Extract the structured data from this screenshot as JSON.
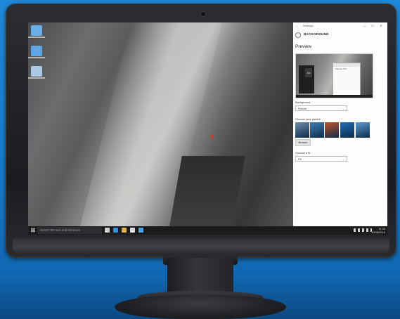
{
  "settings": {
    "window_title": "Settings",
    "back_glyph": "←",
    "controls": [
      "—",
      "☐",
      "✕"
    ],
    "header_icon": "gear-icon",
    "header": "BACKGROUND",
    "preview_heading": "Preview",
    "preview_sample_text": "Sample Text",
    "preview_tile_text": "Aa",
    "background_label": "Background",
    "background_value": "Picture",
    "choose_picture_label": "Choose your picture",
    "browse_label": "Browse",
    "choose_fit_label": "Choose a fit",
    "fit_value": "Fill",
    "picture_colors": [
      "#6f8ea8",
      "#3f7fb5",
      "#c4552a",
      "#1f6fb8",
      "#5b9cd1"
    ]
  },
  "taskbar": {
    "start_glyph": "⊞",
    "search_placeholder": "Search the web and Windows",
    "time": "11:30",
    "date": "10/08/2015",
    "app_icon_colors": [
      "#cfcfcf",
      "#2f8fe0",
      "#e2b13c",
      "#dcdcdc",
      "#4aa0e6"
    ]
  },
  "desktop": {
    "icon_colors": [
      "#6aaee8",
      "#5fa7e4",
      "#a9c8e4"
    ]
  },
  "colors": {
    "background_blue": "#1679c8",
    "monitor_bezel": "#1b1c1f",
    "settings_bg": "#fdfdfd"
  }
}
